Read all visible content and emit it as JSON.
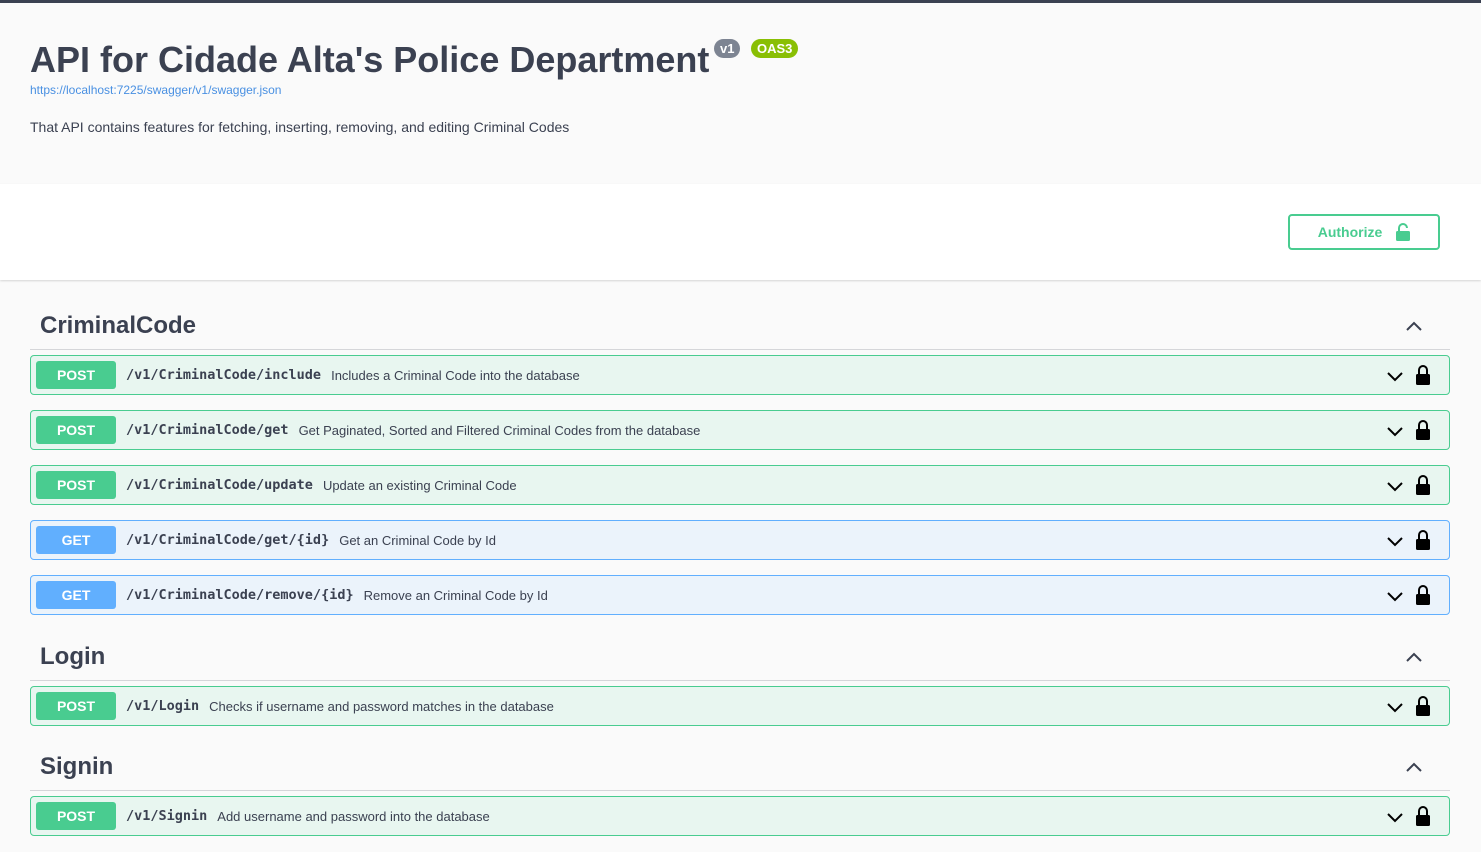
{
  "info": {
    "title": "API for Cidade Alta's Police Department",
    "version_badge": "v1",
    "oas_badge": "OAS3",
    "spec_url": "https://localhost:7225/swagger/v1/swagger.json",
    "description": "That API contains features for fetching, inserting, removing, and editing Criminal Codes"
  },
  "authorize": {
    "label": "Authorize",
    "icon": "lock-open-icon"
  },
  "colors": {
    "post": "#49cc90",
    "get": "#61affe",
    "text": "#3b4151"
  },
  "tags": [
    {
      "name": "CriminalCode",
      "operations": [
        {
          "method": "POST",
          "path": "/v1/CriminalCode/include",
          "summary": "Includes a Criminal Code into the database"
        },
        {
          "method": "POST",
          "path": "/v1/CriminalCode/get",
          "summary": "Get Paginated, Sorted and Filtered Criminal Codes from the database"
        },
        {
          "method": "POST",
          "path": "/v1/CriminalCode/update",
          "summary": "Update an existing Criminal Code"
        },
        {
          "method": "GET",
          "path": "/v1/CriminalCode/get/{id}",
          "summary": "Get an Criminal Code by Id"
        },
        {
          "method": "GET",
          "path": "/v1/CriminalCode/remove/{id}",
          "summary": "Remove an Criminal Code by Id"
        }
      ]
    },
    {
      "name": "Login",
      "operations": [
        {
          "method": "POST",
          "path": "/v1/Login",
          "summary": "Checks if username and password matches in the database"
        }
      ]
    },
    {
      "name": "Signin",
      "operations": [
        {
          "method": "POST",
          "path": "/v1/Signin",
          "summary": "Add username and password into the database"
        }
      ]
    }
  ]
}
